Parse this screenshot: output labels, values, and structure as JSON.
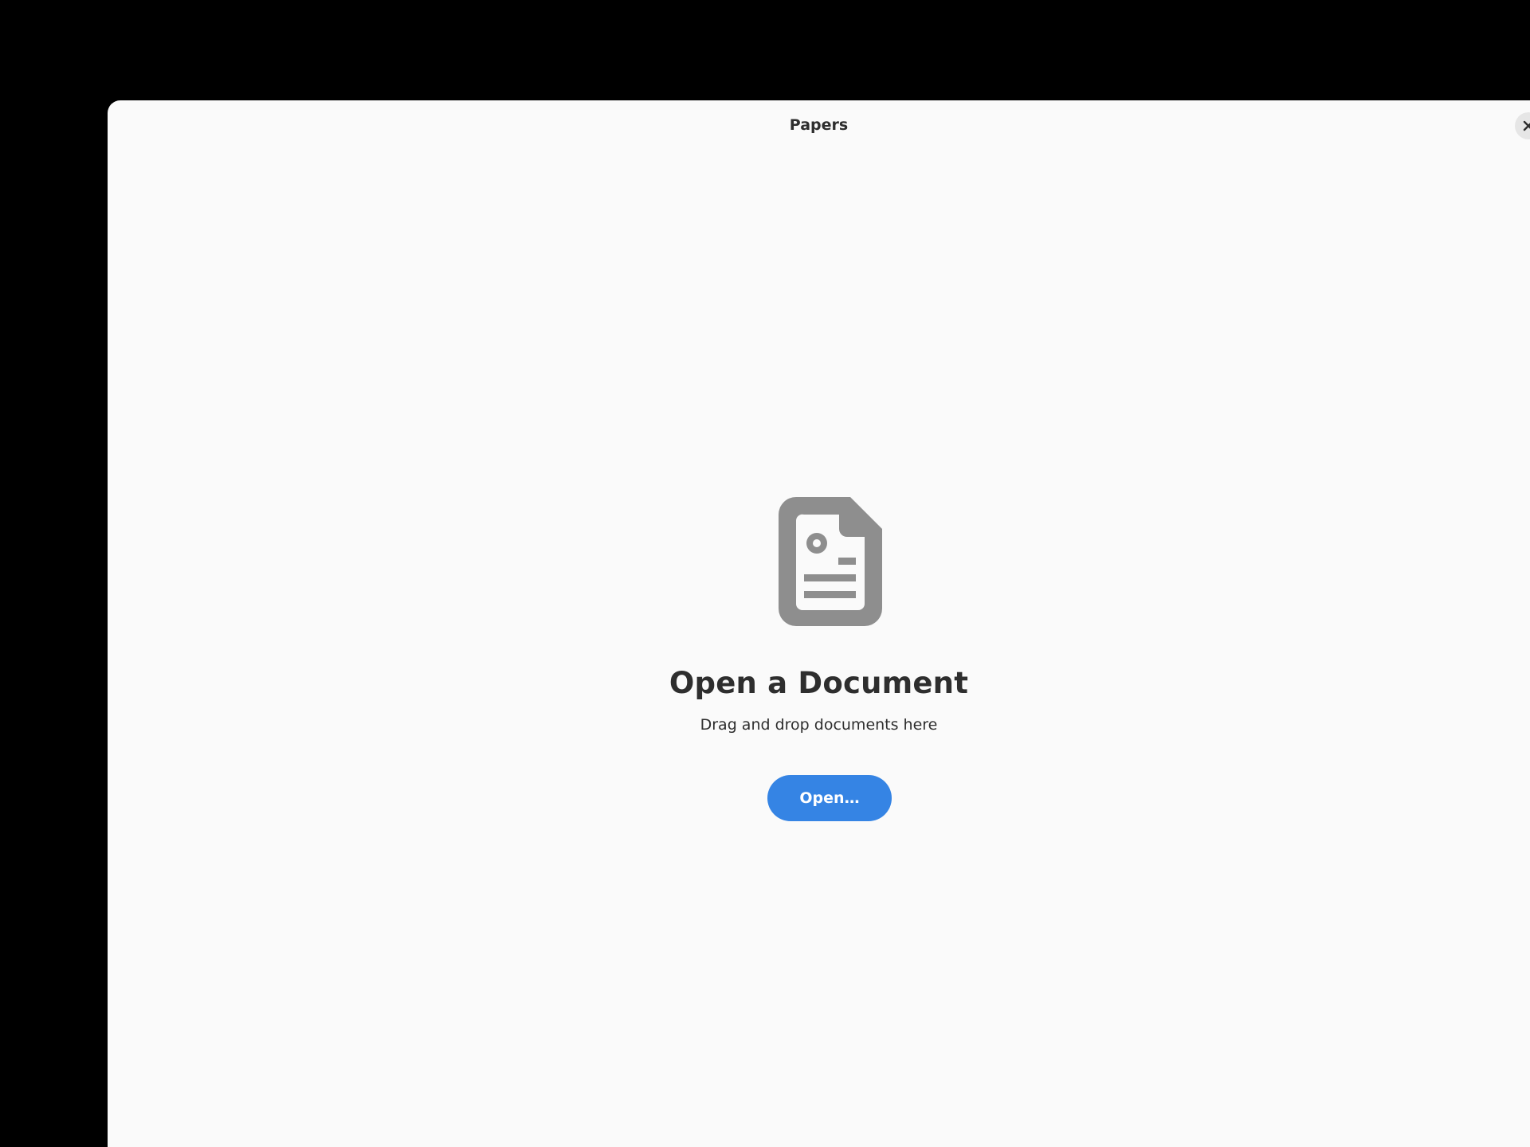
{
  "window": {
    "title": "Papers",
    "close_icon": "close-icon"
  },
  "status_page": {
    "icon": "document-icon",
    "title": "Open a Document",
    "description": "Drag and drop documents here",
    "open_button_label": "Open…"
  },
  "colors": {
    "background": "#fafafa",
    "accent": "#3584e4",
    "icon_gray": "#8e8e8e",
    "text": "#2e2e2e"
  }
}
